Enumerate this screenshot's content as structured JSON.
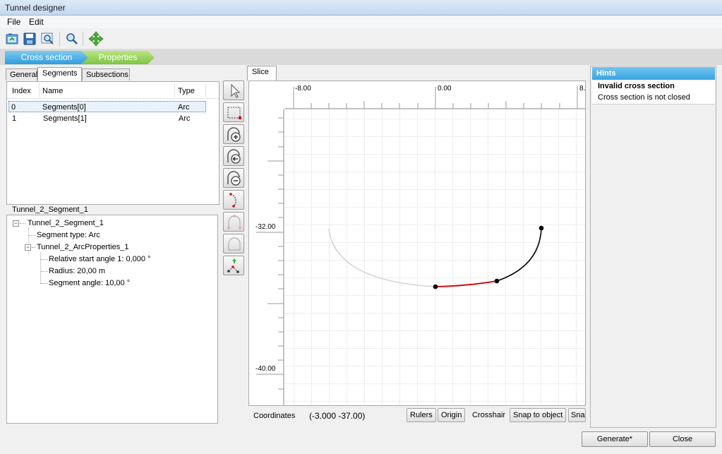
{
  "window": {
    "title": "Tunnel designer"
  },
  "menu": {
    "file": "File",
    "edit": "Edit"
  },
  "breadcrumb": {
    "step1": "Cross section",
    "step2": "Properties"
  },
  "left_tabs": {
    "general": "General",
    "segments": "Segments",
    "subsections": "Subsections"
  },
  "segments_table": {
    "headers": {
      "index": "Index",
      "name": "Name",
      "type": "Type"
    },
    "rows": [
      {
        "index": "0",
        "name": "Segments[0]",
        "type": "Arc"
      },
      {
        "index": "1",
        "name": "Segments[1]",
        "type": "Arc"
      }
    ]
  },
  "properties": {
    "group_label": "Tunnel_2_Segment_1",
    "root": "Tunnel_2_Segment_1",
    "segment_type": "Segment type: Arc",
    "arc_props": "Tunnel_2_ArcProperties_1",
    "start_angle": "Relative start angle 1: 0,000 °",
    "radius": "Radius: 20,00 m",
    "segment_angle": "Segment angle: 10,00 °"
  },
  "slice": {
    "tab": "Slice",
    "hruler": {
      "labels": [
        "-8.00",
        "0.00",
        "8."
      ]
    },
    "vruler": {
      "labels": [
        "-32.00",
        "-40.00"
      ]
    }
  },
  "status": {
    "coords_label": "Coordinates",
    "coords_value": "(-3.000 -37.00)",
    "rulers": "Rulers",
    "origin": "Origin",
    "crosshair": "Crosshair",
    "snap_object": "Snap to object",
    "snap_partial": "Sna"
  },
  "hints": {
    "header": "Hints",
    "title": "Invalid cross section",
    "message": "Cross section is not closed"
  },
  "buttons": {
    "generate": "Generate*",
    "close": "Close"
  },
  "colors": {
    "accent_blue": "#38a3e0",
    "accent_green": "#7fc445",
    "segment_selected": "#d01010",
    "segment": "#000000",
    "segment_ghost": "#d0d0d0"
  }
}
